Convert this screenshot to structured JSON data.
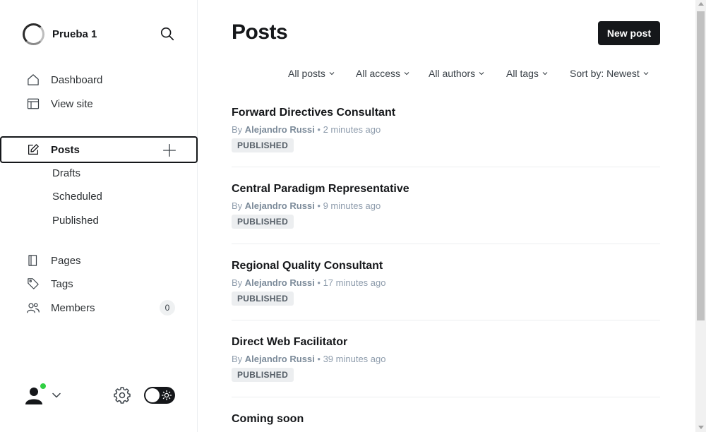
{
  "brand": {
    "name": "Prueba 1"
  },
  "nav": {
    "dashboard": "Dashboard",
    "view_site": "View site",
    "posts": "Posts",
    "drafts": "Drafts",
    "scheduled": "Scheduled",
    "published": "Published",
    "pages": "Pages",
    "tags": "Tags",
    "members": "Members",
    "members_count": "0"
  },
  "header": {
    "title": "Posts",
    "new_post_label": "New post"
  },
  "filters": {
    "type": "All posts",
    "access": "All access",
    "authors": "All authors",
    "tags": "All tags",
    "sort": "Sort by: Newest"
  },
  "posts": [
    {
      "title": "Forward Directives Consultant",
      "by": "By",
      "author": "Alejandro Russi",
      "time": "2 minutes ago",
      "status": "PUBLISHED"
    },
    {
      "title": "Central Paradigm Representative",
      "by": "By",
      "author": "Alejandro Russi",
      "time": "9 minutes ago",
      "status": "PUBLISHED"
    },
    {
      "title": "Regional Quality Consultant",
      "by": "By",
      "author": "Alejandro Russi",
      "time": "17 minutes ago",
      "status": "PUBLISHED"
    },
    {
      "title": "Direct Web Facilitator",
      "by": "By",
      "author": "Alejandro Russi",
      "time": "39 minutes ago",
      "status": "PUBLISHED"
    },
    {
      "title": "Coming soon"
    }
  ],
  "meta_separator": "•",
  "colors": {
    "accent": "#15171a",
    "online": "#30cf43",
    "badge_bg": "#eceef0"
  }
}
